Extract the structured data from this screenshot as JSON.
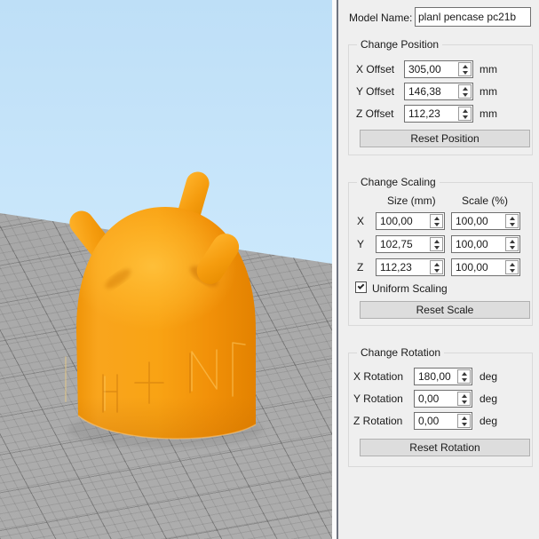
{
  "colors": {
    "model-orange": "#f79d15",
    "model-highlight": "#ffb42c",
    "model-shadow": "#e38200",
    "sky-top": "#bedff7",
    "sky-bottom": "#d9effd",
    "plate": "#a8a8a8",
    "panel-bg": "#efefef"
  },
  "viewport": {
    "model_description": "orange character pencase model on build plate"
  },
  "panel": {
    "model_name": {
      "label": "Model Name:",
      "value": "planl pencase pc21b"
    },
    "position": {
      "title": "Change Position",
      "rows": [
        {
          "label": "X Offset",
          "value": "305,00",
          "unit": "mm"
        },
        {
          "label": "Y Offset",
          "value": "146,38",
          "unit": "mm"
        },
        {
          "label": "Z Offset",
          "value": "112,23",
          "unit": "mm"
        }
      ],
      "reset_label": "Reset Position"
    },
    "scaling": {
      "title": "Change Scaling",
      "col_headers": [
        "Size (mm)",
        "Scale (%)"
      ],
      "rows": [
        {
          "axis": "X",
          "size": "100,00",
          "scale": "100,00"
        },
        {
          "axis": "Y",
          "size": "102,75",
          "scale": "100,00"
        },
        {
          "axis": "Z",
          "size": "112,23",
          "scale": "100,00"
        }
      ],
      "uniform_label": "Uniform Scaling",
      "uniform_checked": true,
      "reset_label": "Reset Scale"
    },
    "rotation": {
      "title": "Change Rotation",
      "rows": [
        {
          "label": "X Rotation",
          "value": "180,00",
          "unit": "deg"
        },
        {
          "label": "Y Rotation",
          "value": "0,00",
          "unit": "deg"
        },
        {
          "label": "Z Rotation",
          "value": "0,00",
          "unit": "deg"
        }
      ],
      "reset_label": "Reset Rotation"
    }
  }
}
